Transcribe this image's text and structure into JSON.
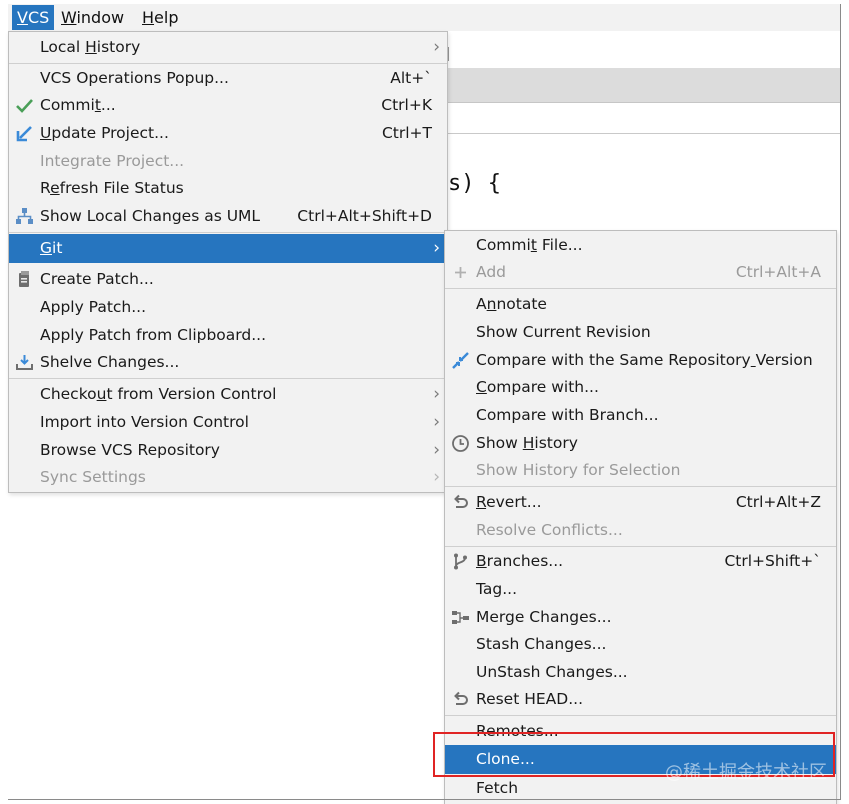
{
  "menubar": {
    "items": [
      {
        "label": "VCS",
        "u": 0
      },
      {
        "label": "Window",
        "u": 0
      },
      {
        "label": "Help",
        "u": 0
      }
    ]
  },
  "editor": {
    "code_fragment": "s) {"
  },
  "vcs_menu": {
    "items": [
      {
        "label": "Local History",
        "u": 6,
        "submenu": true
      },
      {
        "label": "VCS Operations Popup...",
        "shortcut": "Alt+`"
      },
      {
        "label": "Commit...",
        "u": 5,
        "shortcut": "Ctrl+K",
        "icon": "check-icon"
      },
      {
        "label": "Update Project...",
        "u": 0,
        "shortcut": "Ctrl+T",
        "icon": "update-arrow-icon"
      },
      {
        "label": "Integrate Project...",
        "disabled": true
      },
      {
        "label": "Refresh File Status",
        "u": 1
      },
      {
        "label": "Show Local Changes as UML",
        "shortcut": "Ctrl+Alt+Shift+D",
        "icon": "uml-diagram-icon"
      },
      {
        "label": "Git",
        "u": 0,
        "submenu": true,
        "selected": true
      },
      {
        "label": "Create Patch...",
        "icon": "patch-icon"
      },
      {
        "label": "Apply Patch..."
      },
      {
        "label": "Apply Patch from Clipboard..."
      },
      {
        "label": "Shelve Changes...",
        "icon": "shelve-icon"
      },
      {
        "label": "Checkout from Version Control",
        "u": 6,
        "submenu": true
      },
      {
        "label": "Import into Version Control",
        "submenu": true
      },
      {
        "label": "Browse VCS Repository",
        "submenu": true
      },
      {
        "label": "Sync Settings",
        "disabled": true,
        "submenu": true
      }
    ]
  },
  "git_menu": {
    "items": [
      {
        "label": "Commit File...",
        "u": 5
      },
      {
        "label": "Add",
        "shortcut": "Ctrl+Alt+A",
        "disabled": true,
        "icon": "plus-icon"
      },
      {
        "label": "Annotate",
        "u": 1
      },
      {
        "label": "Show Current Revision"
      },
      {
        "label": "Compare with the Same Repository Version",
        "u": 32,
        "icon": "compare-arrows-icon"
      },
      {
        "label": "Compare with...",
        "u": 0
      },
      {
        "label": "Compare with Branch..."
      },
      {
        "label": "Show History",
        "u": 5,
        "icon": "clock-icon"
      },
      {
        "label": "Show History for Selection",
        "disabled": true
      },
      {
        "label": "Revert...",
        "u": 0,
        "shortcut": "Ctrl+Alt+Z",
        "icon": "revert-icon"
      },
      {
        "label": "Resolve Conflicts...",
        "disabled": true
      },
      {
        "label": "Branches...",
        "u": 0,
        "shortcut": "Ctrl+Shift+`",
        "icon": "branch-icon"
      },
      {
        "label": "Tag..."
      },
      {
        "label": "Merge Changes...",
        "icon": "merge-icon"
      },
      {
        "label": "Stash Changes..."
      },
      {
        "label": "UnStash Changes..."
      },
      {
        "label": "Reset HEAD...",
        "icon": "reset-icon"
      },
      {
        "label": "Remotes..."
      },
      {
        "label": "Clone...",
        "selected": true
      },
      {
        "label": "Fetch"
      }
    ]
  },
  "watermark": "@稀土掘金技术社区",
  "colors": {
    "selection": "#2675bf",
    "menu_bg": "#f2f2f2",
    "disabled": "#9a9a9a",
    "highlight_border": "#e02424",
    "check_green": "#4a9f58",
    "icon_blue": "#3a8ad8"
  }
}
